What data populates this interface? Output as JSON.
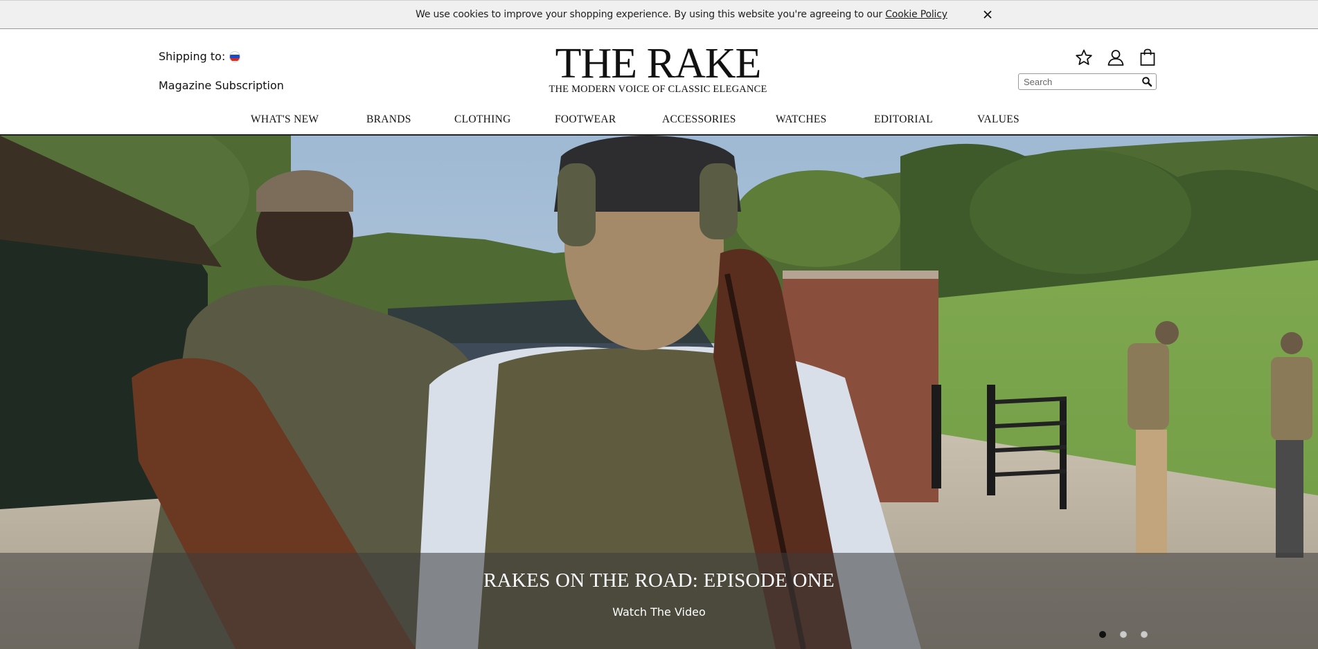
{
  "cookie_bar": {
    "text": "We use cookies to improve your shopping experience. By using this website you're agreeing to our ",
    "link_label": "Cookie Policy",
    "close_icon": "close-icon"
  },
  "header": {
    "shipping_label": "Shipping to:",
    "shipping_country_flag": "russia-flag-icon",
    "magazine_link": "Magazine Subscription",
    "logo_title": "THE RAKE",
    "logo_tagline": "THE MODERN VOICE OF CLASSIC ELEGANCE",
    "icons": [
      "star-icon",
      "user-icon",
      "shopping-bag-icon"
    ],
    "search": {
      "placeholder": "Search",
      "value": ""
    }
  },
  "nav": {
    "items": [
      {
        "label": "WHAT'S NEW"
      },
      {
        "label": "BRANDS"
      },
      {
        "label": "CLOTHING"
      },
      {
        "label": "FOOTWEAR"
      },
      {
        "label": "ACCESSORIES"
      },
      {
        "label": "WATCHES"
      },
      {
        "label": "EDITORIAL"
      },
      {
        "label": "VALUES"
      }
    ]
  },
  "hero": {
    "title": "RAKES ON THE ROAD: EPISODE ONE",
    "cta": "Watch The Video",
    "slides_count": 3,
    "active_slide": 1
  },
  "colors": {
    "cookie_bg": "#f0f0f0",
    "text": "#111111",
    "overlay": "rgba(60,60,60,0.55)"
  }
}
